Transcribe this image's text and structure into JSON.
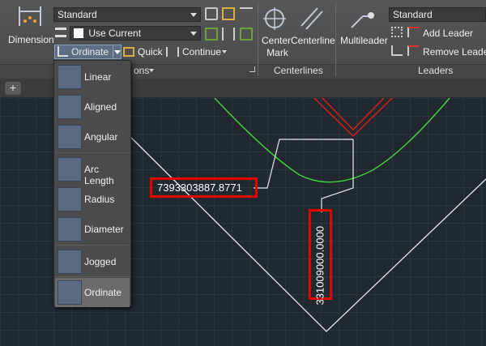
{
  "ribbon": {
    "dimension_label": "Dimension",
    "dim_style_value": "Standard",
    "layer_value": "Use Current",
    "ordinate_label": "Ordinate",
    "quick_label": "Quick",
    "continue_label": "Continue",
    "dimensions_group_title": "ons",
    "center_mark_label_1": "Center",
    "center_mark_label_2": "Mark",
    "centerline_label": "Centerline",
    "centerlines_group_title": "Centerlines",
    "multileader_label": "Multileader",
    "leader_style_value": "Standard",
    "add_leader_label": "Add Leader",
    "remove_leader_label": "Remove Leader",
    "leaders_group_title": "Leaders"
  },
  "tabs": {
    "new_tab": "+"
  },
  "menu": {
    "items": [
      {
        "label": "Linear"
      },
      {
        "label": "Aligned"
      },
      {
        "label": "Angular"
      },
      {
        "label": "Arc Length"
      },
      {
        "label": "Radius"
      },
      {
        "label": "Diameter"
      },
      {
        "label": "Jogged"
      },
      {
        "label": "Ordinate"
      }
    ]
  },
  "drawing": {
    "dim_x": "7393303887.8771",
    "dim_y": "331009000.0000"
  }
}
